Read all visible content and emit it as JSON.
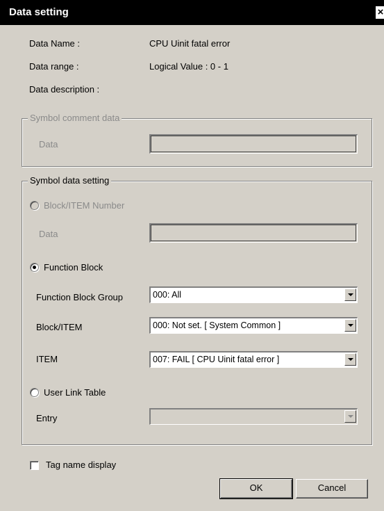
{
  "window": {
    "title": "Data setting",
    "close_glyph": "×"
  },
  "info": {
    "data_name_label": "Data Name :",
    "data_name_value": "CPU Uinit fatal error",
    "data_range_label": "Data range :",
    "data_range_value": "Logical Value : 0 - 1",
    "data_description_label": "Data description :"
  },
  "symbol_comment": {
    "legend": "Symbol comment data",
    "data_label": "Data",
    "data_value": ""
  },
  "symbol_setting": {
    "legend": "Symbol data setting",
    "block_item_number_label": "Block/ITEM Number",
    "block_item_data_label": "Data",
    "block_item_data_value": "",
    "function_block_label": "Function Block",
    "function_block_group_label": "Function Block Group",
    "function_block_group_value": "000: All",
    "block_item_label": "Block/ITEM",
    "block_item_value": "000: Not set. [ System Common ]",
    "item_label": "ITEM",
    "item_value": "007: FAIL [ CPU Uinit fatal error ]",
    "user_link_table_label": "User Link Table",
    "entry_label": "Entry",
    "entry_value": ""
  },
  "tag_name_display_label": "Tag name display",
  "buttons": {
    "ok": "OK",
    "cancel": "Cancel"
  }
}
